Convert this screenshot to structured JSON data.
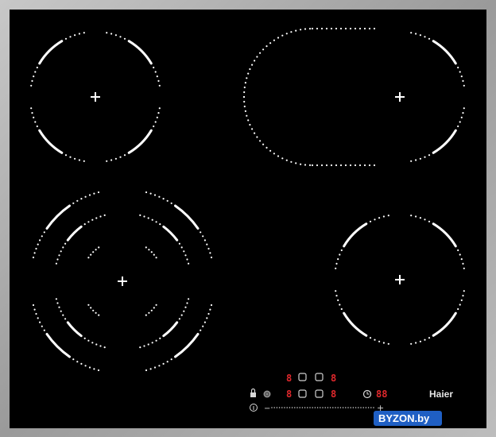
{
  "product": {
    "brand": "Haier",
    "frame_color": "#a9a9a9",
    "glass_color": "#000000",
    "marking_color": "#ffffff",
    "display_color": "#e0282c",
    "zones": [
      {
        "id": "front-left",
        "style": "single"
      },
      {
        "id": "rear-right",
        "style": "oval-extended"
      },
      {
        "id": "rear-left",
        "style": "triple-ring"
      },
      {
        "id": "front-right",
        "style": "single"
      }
    ],
    "controls": {
      "zone_displays_top": [
        "8",
        "8"
      ],
      "zone_displays_bottom": [
        "8",
        "8"
      ],
      "timer_display": "88",
      "icons": [
        "lock-icon",
        "power-icon",
        "clock-icon",
        "info-icon"
      ],
      "slider_minus": "−",
      "slider_plus": "+"
    }
  },
  "watermark": {
    "text": "BYZON.by",
    "badge_color": "#1f5fc4"
  }
}
